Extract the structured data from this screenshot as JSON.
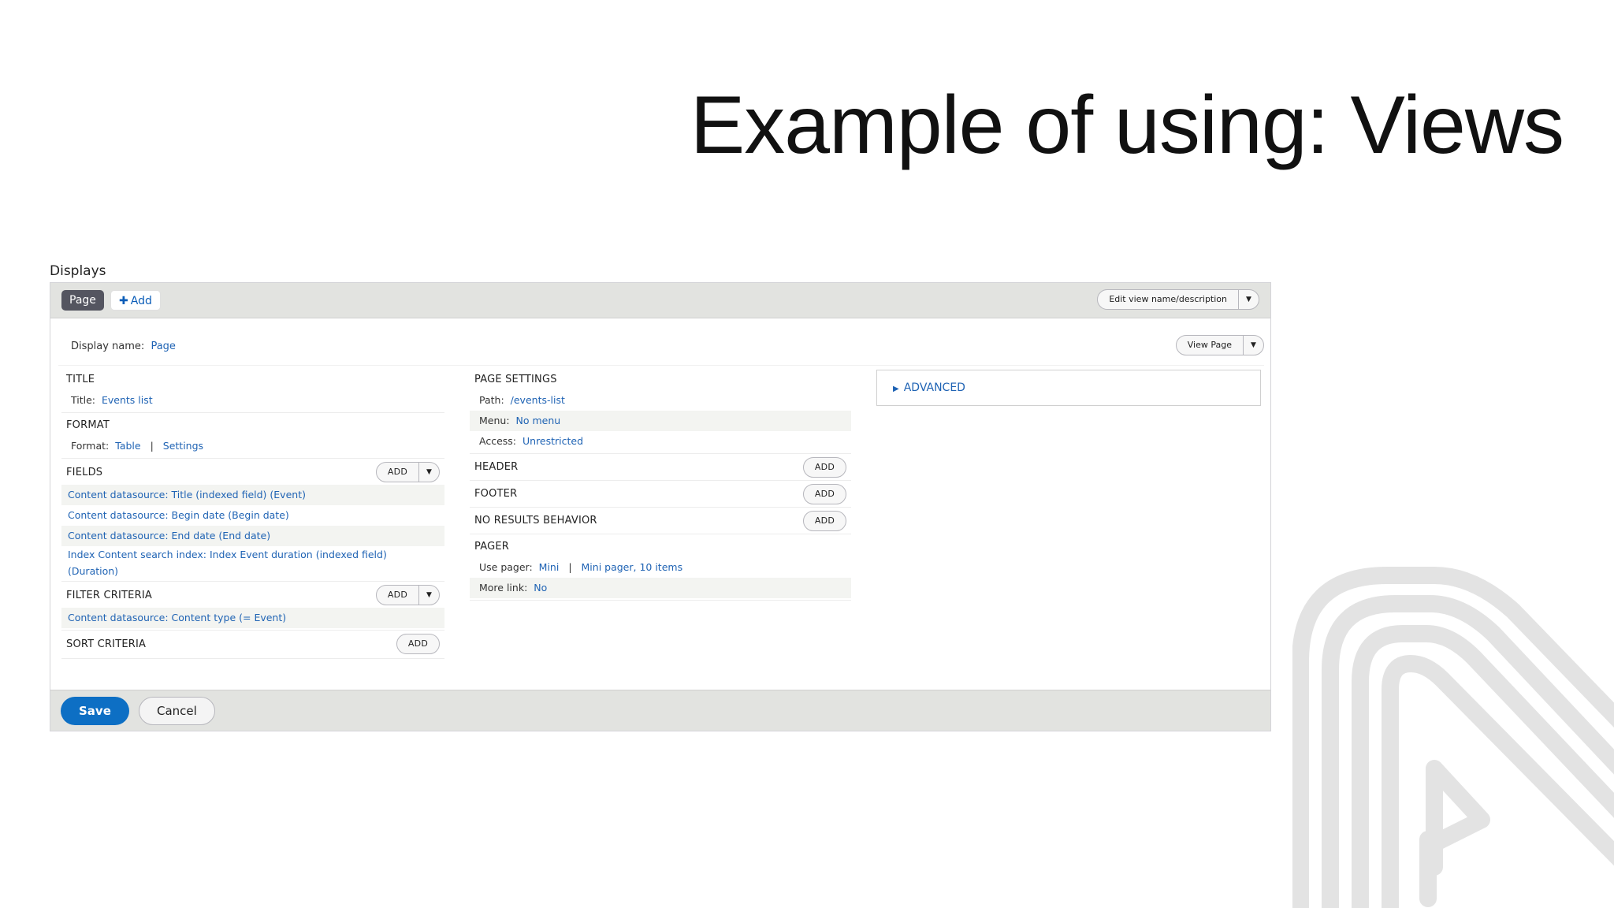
{
  "slide": {
    "title": "Example of using: Views"
  },
  "displays": {
    "label": "Displays",
    "tabs": {
      "page": "Page",
      "add": "Add"
    },
    "edit_view_label": "Edit view name/description",
    "display_name_label": "Display name:",
    "display_name_value": "Page",
    "view_page_label": "View Page",
    "advanced_label": "Advanced"
  },
  "left": {
    "title": {
      "header": "Title",
      "label": "Title:",
      "value": "Events list"
    },
    "format": {
      "header": "Format",
      "label": "Format:",
      "value": "Table",
      "settings": "Settings"
    },
    "fields": {
      "header": "Fields",
      "add": "Add",
      "items": [
        "Content datasource: Title (indexed field) (Event)",
        "Content datasource: Begin date (Begin date)",
        "Content datasource: End date (End date)",
        "Index Content search index: Index Event duration (indexed field) (Duration)"
      ]
    },
    "filter": {
      "header": "Filter criteria",
      "add": "Add",
      "items": [
        "Content datasource: Content type (= Event)"
      ]
    },
    "sort": {
      "header": "Sort criteria",
      "add": "Add"
    }
  },
  "middle": {
    "page_settings": {
      "header": "Page settings",
      "path_label": "Path:",
      "path_value": "/events-list",
      "menu_label": "Menu:",
      "menu_value": "No menu",
      "access_label": "Access:",
      "access_value": "Unrestricted"
    },
    "header_section": {
      "header": "Header",
      "add": "Add"
    },
    "footer_section": {
      "header": "Footer",
      "add": "Add"
    },
    "no_results": {
      "header": "No results behavior",
      "add": "Add"
    },
    "pager": {
      "header": "Pager",
      "use_pager_label": "Use pager:",
      "use_pager_value": "Mini",
      "use_pager_detail": "Mini pager, 10 items",
      "more_link_label": "More link:",
      "more_link_value": "No"
    }
  },
  "actions": {
    "save": "Save",
    "cancel": "Cancel"
  }
}
